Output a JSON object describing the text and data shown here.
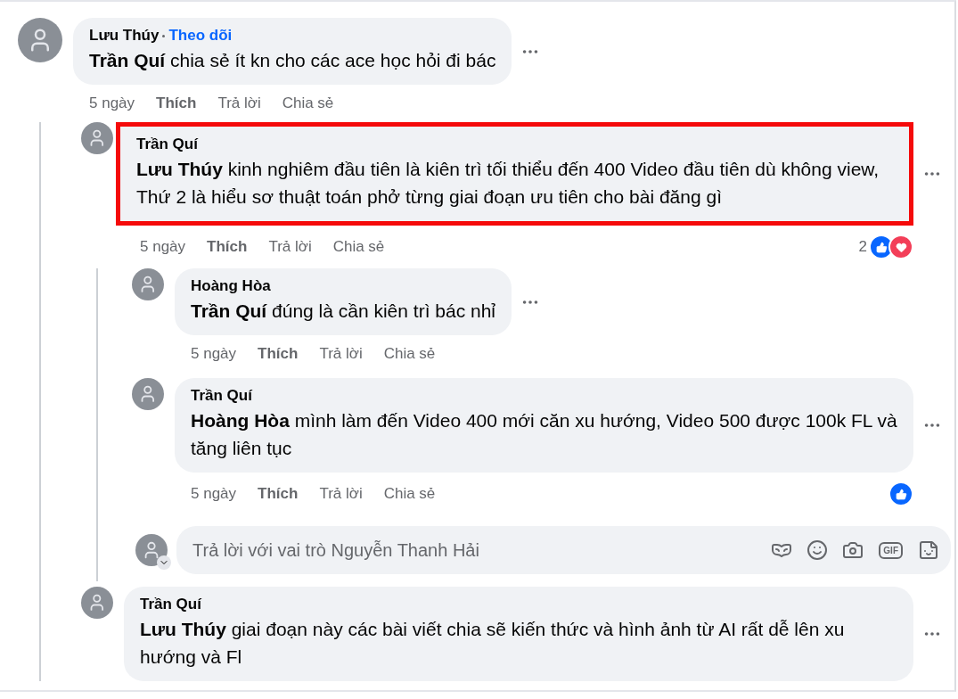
{
  "comments": [
    {
      "author": "Lưu Thúy",
      "follow": "Theo dõi",
      "text": "**Trần Quí** chia sẻ ít kn cho các ace học hỏi đi bác",
      "time": "5 ngày",
      "actions": [
        "Thích",
        "Trả lời",
        "Chia sẻ"
      ],
      "highlighted": false,
      "replies": [
        {
          "author": "Trần Quí",
          "text": "**Lưu Thúy** kinh nghiêm đầu tiên là kiên trì tối thiểu đến 400 Video đầu tiên dù không view, Thứ 2 là hiểu sơ thuật toán phở từng giai đoạn ưu tiên cho bài đăng gì",
          "time": "5 ngày",
          "actions": [
            "Thích",
            "Trả lời",
            "Chia sẻ"
          ],
          "highlighted": true,
          "reactions": {
            "count": "2",
            "like": true,
            "love": true
          },
          "replies": [
            {
              "author": "Hoàng Hòa",
              "text": "**Trần Quí** đúng là cần kiên trì bác nhỉ",
              "time": "5 ngày",
              "actions": [
                "Thích",
                "Trả lời",
                "Chia sẻ"
              ],
              "highlighted": false
            },
            {
              "author": "Trần Quí",
              "text": "**Hoàng Hòa** mình làm đến Video 400 mới căn xu hướng, Video 500 được 100k FL và tăng liên tục",
              "time": "5 ngày",
              "actions": [
                "Thích",
                "Trả lời",
                "Chia sẻ"
              ],
              "highlighted": false,
              "reactions": {
                "like": true
              }
            }
          ],
          "reply_box": {
            "placeholder": "Trả lời với vai trò Nguyễn Thanh Hải",
            "gif": "GIF"
          }
        },
        {
          "author": "Trần Quí",
          "text": "**Lưu Thúy** giai đoạn này các bài viết chia sẽ kiến thức và hình ảnh từ AI rất dễ lên xu hướng và Fl",
          "highlighted": false
        }
      ]
    }
  ]
}
